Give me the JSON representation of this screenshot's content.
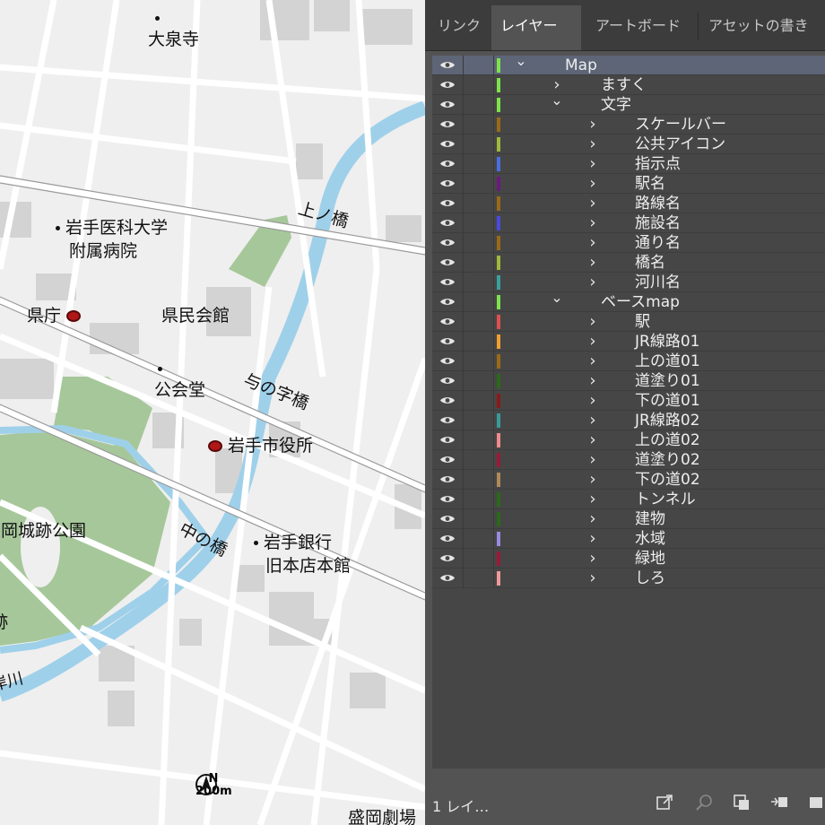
{
  "map": {
    "labels": [
      {
        "id": "daisenji",
        "text": "大泉寺",
        "marker": "dot"
      },
      {
        "id": "hospital1",
        "text": "岩手医科大学",
        "marker": "dot"
      },
      {
        "id": "hospital2",
        "text": "附属病院",
        "marker": "none"
      },
      {
        "id": "kencho",
        "text": "県庁",
        "marker": "red"
      },
      {
        "id": "kenmin",
        "text": "県民会館",
        "marker": "none"
      },
      {
        "id": "kokaido",
        "text": "公会堂",
        "marker": "dot"
      },
      {
        "id": "shiyakusho",
        "text": "岩手市役所",
        "marker": "red"
      },
      {
        "id": "park",
        "text": "盛岡城跡公園",
        "marker": "none"
      },
      {
        "id": "bank1",
        "text": "岩手銀行",
        "marker": "dot"
      },
      {
        "id": "bank2",
        "text": "旧本店本館",
        "marker": "none"
      },
      {
        "id": "park2",
        "text": "跡",
        "marker": "none"
      },
      {
        "id": "river",
        "text": "岸川",
        "marker": "none"
      },
      {
        "id": "gekijo",
        "text": "盛岡劇場",
        "marker": "none"
      }
    ],
    "bridges": [
      {
        "id": "kaminohashi",
        "text": "上ノ橋"
      },
      {
        "id": "yonojibashi",
        "text": "与の字橋"
      },
      {
        "id": "nakanohashi",
        "text": "中の橋"
      }
    ],
    "scale": {
      "north": "N",
      "distance": "200m"
    }
  },
  "panel": {
    "tabs": [
      {
        "label": "リンク",
        "active": false
      },
      {
        "label": "レイヤー",
        "active": true
      },
      {
        "label": "アートボード",
        "active": false
      },
      {
        "label": "アセットの書き",
        "active": false
      }
    ],
    "layers": [
      {
        "name": "Map",
        "depth": 0,
        "expanded": true,
        "color": "#7ee24a",
        "selected": true
      },
      {
        "name": "ますく",
        "depth": 1,
        "expanded": false,
        "color": "#7ee24a"
      },
      {
        "name": "文字",
        "depth": 1,
        "expanded": true,
        "color": "#7ee24a"
      },
      {
        "name": "スケールバー",
        "depth": 2,
        "expanded": false,
        "color": "#9a6a1a"
      },
      {
        "name": "公共アイコン",
        "depth": 2,
        "expanded": false,
        "color": "#a0b83c"
      },
      {
        "name": "指示点",
        "depth": 2,
        "expanded": false,
        "color": "#4a6ee0"
      },
      {
        "name": "駅名",
        "depth": 2,
        "expanded": false,
        "color": "#6a1a7a"
      },
      {
        "name": "路線名",
        "depth": 2,
        "expanded": false,
        "color": "#9a6a1a"
      },
      {
        "name": "施設名",
        "depth": 2,
        "expanded": false,
        "color": "#4a4ae0"
      },
      {
        "name": "通り名",
        "depth": 2,
        "expanded": false,
        "color": "#9a6a1a"
      },
      {
        "name": "橋名",
        "depth": 2,
        "expanded": false,
        "color": "#a0b83c"
      },
      {
        "name": "河川名",
        "depth": 2,
        "expanded": false,
        "color": "#3aa0a0"
      },
      {
        "name": "ベースmap",
        "depth": 1,
        "expanded": true,
        "color": "#7ee24a"
      },
      {
        "name": "駅",
        "depth": 2,
        "expanded": false,
        "color": "#e05050"
      },
      {
        "name": "JR線路01",
        "depth": 2,
        "expanded": false,
        "color": "#f0a030"
      },
      {
        "name": "上の道01",
        "depth": 2,
        "expanded": false,
        "color": "#9a6a1a"
      },
      {
        "name": "道塗り01",
        "depth": 2,
        "expanded": false,
        "color": "#2a6a1a"
      },
      {
        "name": "下の道01",
        "depth": 2,
        "expanded": false,
        "color": "#8a1a1a"
      },
      {
        "name": "JR線路02",
        "depth": 2,
        "expanded": false,
        "color": "#3a9a9a"
      },
      {
        "name": "上の道02",
        "depth": 2,
        "expanded": false,
        "color": "#f08a8a"
      },
      {
        "name": "道塗り02",
        "depth": 2,
        "expanded": false,
        "color": "#9a1a3a"
      },
      {
        "name": "下の道02",
        "depth": 2,
        "expanded": false,
        "color": "#b08a5a"
      },
      {
        "name": "トンネル",
        "depth": 2,
        "expanded": false,
        "color": "#2a6a1a"
      },
      {
        "name": "建物",
        "depth": 2,
        "expanded": false,
        "color": "#2a6a1a"
      },
      {
        "name": "水域",
        "depth": 2,
        "expanded": false,
        "color": "#9a8ae0"
      },
      {
        "name": "緑地",
        "depth": 2,
        "expanded": false,
        "color": "#9a1a3a"
      },
      {
        "name": "しろ",
        "depth": 2,
        "expanded": false,
        "color": "#f09a9a"
      }
    ],
    "footer": {
      "count": "1 レイ…",
      "icons": [
        "export-icon",
        "search-icon",
        "collect-icon",
        "merge-icon",
        "new-layer-icon"
      ]
    }
  }
}
